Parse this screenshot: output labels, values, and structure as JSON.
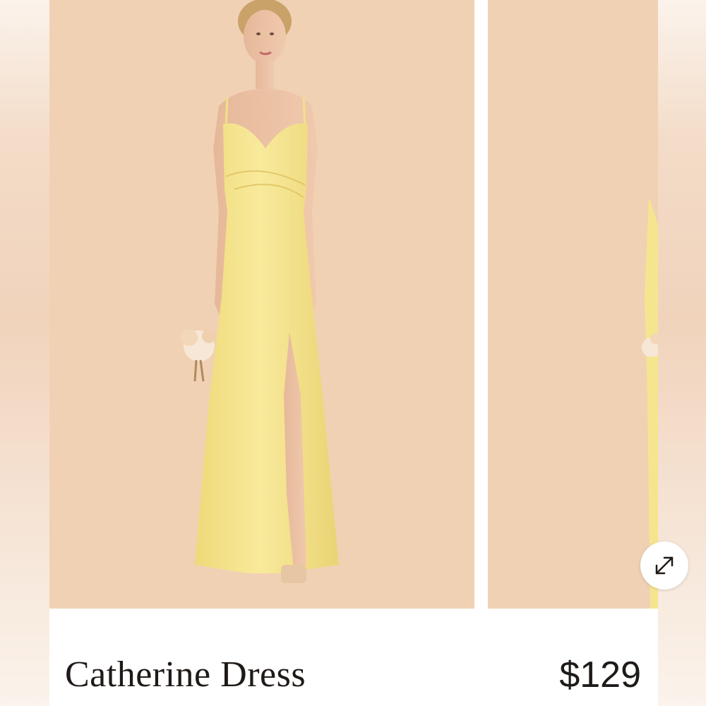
{
  "product": {
    "name": "Catherine Dress",
    "price": "$129"
  },
  "gallery": {
    "slides": [
      {
        "subject": "model-in-yellow-satin-slip-dress-with-bouquet"
      },
      {
        "subject": "model-in-yellow-satin-slip-dress-side-view"
      }
    ],
    "expand_icon": "expand-arrows-icon"
  },
  "colors": {
    "backdrop": "#f1d1b4",
    "dress": "#f5e58e",
    "text": "#1f1a17"
  }
}
